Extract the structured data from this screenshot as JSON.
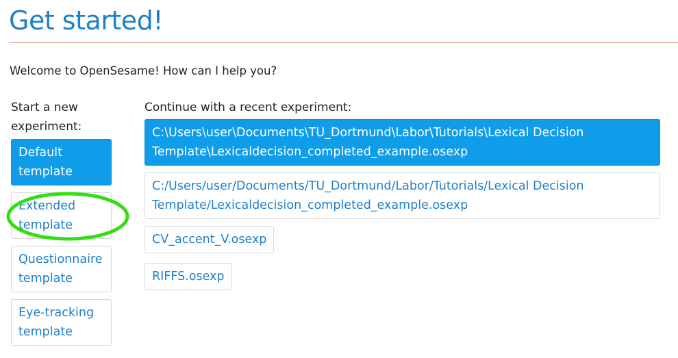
{
  "title": "Get started!",
  "welcome": "Welcome to OpenSesame! How can I help you?",
  "new_experiment": {
    "heading_line1": "Start a new",
    "heading_line2": "experiment:",
    "templates": [
      {
        "line1": "Default",
        "line2": "template",
        "active": true
      },
      {
        "line1": "Extended",
        "line2": "template",
        "active": false
      },
      {
        "line1": "Questionnaire",
        "line2": "template",
        "active": false
      },
      {
        "line1": "Eye-tracking",
        "line2": "template",
        "active": false
      }
    ]
  },
  "recent": {
    "heading": "Continue with a recent experiment:",
    "items": [
      {
        "line1": "C:\\Users\\user\\Documents\\TU_Dortmund\\Labor\\Tutorials\\Lexical Decision",
        "line2": "Template\\Lexicaldecision_completed_example.osexp",
        "active": true
      },
      {
        "line1": "C:/Users/user/Documents/TU_Dortmund/Labor/Tutorials/Lexical Decision",
        "line2": "Template/Lexicaldecision_completed_example.osexp",
        "active": false
      },
      {
        "label": "CV_accent_V.osexp"
      },
      {
        "label": "RIFFS.osexp"
      }
    ]
  },
  "colors": {
    "accent": "#1e80c8",
    "active_button": "#0f9ce8",
    "rule": "#e7896a",
    "highlight": "#33dd11"
  }
}
